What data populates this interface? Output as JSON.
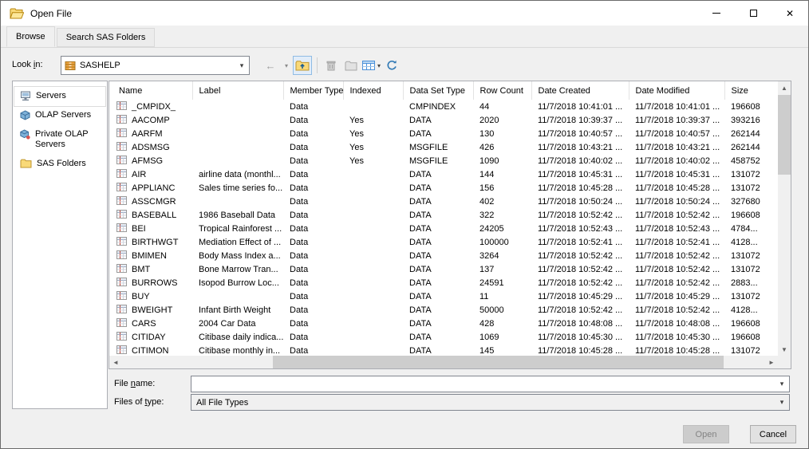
{
  "window": {
    "title": "Open File"
  },
  "icons": {
    "close": "✕",
    "back_arrow": "←",
    "caret_down": "▾",
    "scroll_up": "▲",
    "scroll_down": "▼",
    "scroll_left": "◄",
    "scroll_right": "►"
  },
  "tabs": [
    {
      "label": "Browse"
    },
    {
      "label": "Search SAS Folders"
    }
  ],
  "look_in": {
    "label": {
      "pre": "Look ",
      "accel": "i",
      "post": "n:"
    },
    "value": "SASHELP"
  },
  "sidebar": {
    "items": [
      {
        "label": "Servers"
      },
      {
        "label": "OLAP Servers"
      },
      {
        "label": "Private OLAP Servers"
      },
      {
        "label": "SAS Folders"
      }
    ]
  },
  "table": {
    "columns": [
      "Name",
      "Label",
      "Member Type",
      "Indexed",
      "Data Set Type",
      "Row Count",
      "Date Created",
      "Date Modified",
      "Size"
    ],
    "rows": [
      {
        "name": "_CMPIDX_",
        "label": "",
        "member_type": "Data",
        "indexed": "",
        "data_set_type": "CMPINDEX",
        "row_count": "44",
        "date_created": "11/7/2018 10:41:01 ...",
        "date_modified": "11/7/2018 10:41:01 ...",
        "size": "196608"
      },
      {
        "name": "AACOMP",
        "label": "",
        "member_type": "Data",
        "indexed": "Yes",
        "data_set_type": "DATA",
        "row_count": "2020",
        "date_created": "11/7/2018 10:39:37 ...",
        "date_modified": "11/7/2018 10:39:37 ...",
        "size": "393216"
      },
      {
        "name": "AARFM",
        "label": "",
        "member_type": "Data",
        "indexed": "Yes",
        "data_set_type": "DATA",
        "row_count": "130",
        "date_created": "11/7/2018 10:40:57 ...",
        "date_modified": "11/7/2018 10:40:57 ...",
        "size": "262144"
      },
      {
        "name": "ADSMSG",
        "label": "",
        "member_type": "Data",
        "indexed": "Yes",
        "data_set_type": "MSGFILE",
        "row_count": "426",
        "date_created": "11/7/2018 10:43:21 ...",
        "date_modified": "11/7/2018 10:43:21 ...",
        "size": "262144"
      },
      {
        "name": "AFMSG",
        "label": "",
        "member_type": "Data",
        "indexed": "Yes",
        "data_set_type": "MSGFILE",
        "row_count": "1090",
        "date_created": "11/7/2018 10:40:02 ...",
        "date_modified": "11/7/2018 10:40:02 ...",
        "size": "458752"
      },
      {
        "name": "AIR",
        "label": "airline data (monthl...",
        "member_type": "Data",
        "indexed": "",
        "data_set_type": "DATA",
        "row_count": "144",
        "date_created": "11/7/2018 10:45:31 ...",
        "date_modified": "11/7/2018 10:45:31 ...",
        "size": "131072"
      },
      {
        "name": "APPLIANC",
        "label": "Sales time series fo...",
        "member_type": "Data",
        "indexed": "",
        "data_set_type": "DATA",
        "row_count": "156",
        "date_created": "11/7/2018 10:45:28 ...",
        "date_modified": "11/7/2018 10:45:28 ...",
        "size": "131072"
      },
      {
        "name": "ASSCMGR",
        "label": "",
        "member_type": "Data",
        "indexed": "",
        "data_set_type": "DATA",
        "row_count": "402",
        "date_created": "11/7/2018 10:50:24 ...",
        "date_modified": "11/7/2018 10:50:24 ...",
        "size": "327680"
      },
      {
        "name": "BASEBALL",
        "label": "1986 Baseball Data",
        "member_type": "Data",
        "indexed": "",
        "data_set_type": "DATA",
        "row_count": "322",
        "date_created": "11/7/2018 10:52:42 ...",
        "date_modified": "11/7/2018 10:52:42 ...",
        "size": "196608"
      },
      {
        "name": "BEI",
        "label": "Tropical Rainforest ...",
        "member_type": "Data",
        "indexed": "",
        "data_set_type": "DATA",
        "row_count": "24205",
        "date_created": "11/7/2018 10:52:43 ...",
        "date_modified": "11/7/2018 10:52:43 ...",
        "size": "4784..."
      },
      {
        "name": "BIRTHWGT",
        "label": "Mediation Effect of ...",
        "member_type": "Data",
        "indexed": "",
        "data_set_type": "DATA",
        "row_count": "100000",
        "date_created": "11/7/2018 10:52:41 ...",
        "date_modified": "11/7/2018 10:52:41 ...",
        "size": "4128..."
      },
      {
        "name": "BMIMEN",
        "label": "Body Mass Index a...",
        "member_type": "Data",
        "indexed": "",
        "data_set_type": "DATA",
        "row_count": "3264",
        "date_created": "11/7/2018 10:52:42 ...",
        "date_modified": "11/7/2018 10:52:42 ...",
        "size": "131072"
      },
      {
        "name": "BMT",
        "label": "Bone Marrow Tran...",
        "member_type": "Data",
        "indexed": "",
        "data_set_type": "DATA",
        "row_count": "137",
        "date_created": "11/7/2018 10:52:42 ...",
        "date_modified": "11/7/2018 10:52:42 ...",
        "size": "131072"
      },
      {
        "name": "BURROWS",
        "label": "Isopod Burrow Loc...",
        "member_type": "Data",
        "indexed": "",
        "data_set_type": "DATA",
        "row_count": "24591",
        "date_created": "11/7/2018 10:52:42 ...",
        "date_modified": "11/7/2018 10:52:42 ...",
        "size": "2883..."
      },
      {
        "name": "BUY",
        "label": "",
        "member_type": "Data",
        "indexed": "",
        "data_set_type": "DATA",
        "row_count": "11",
        "date_created": "11/7/2018 10:45:29 ...",
        "date_modified": "11/7/2018 10:45:29 ...",
        "size": "131072"
      },
      {
        "name": "BWEIGHT",
        "label": "Infant Birth Weight",
        "member_type": "Data",
        "indexed": "",
        "data_set_type": "DATA",
        "row_count": "50000",
        "date_created": "11/7/2018 10:52:42 ...",
        "date_modified": "11/7/2018 10:52:42 ...",
        "size": "4128..."
      },
      {
        "name": "CARS",
        "label": "2004 Car Data",
        "member_type": "Data",
        "indexed": "",
        "data_set_type": "DATA",
        "row_count": "428",
        "date_created": "11/7/2018 10:48:08 ...",
        "date_modified": "11/7/2018 10:48:08 ...",
        "size": "196608"
      },
      {
        "name": "CITIDAY",
        "label": "Citibase daily indica...",
        "member_type": "Data",
        "indexed": "",
        "data_set_type": "DATA",
        "row_count": "1069",
        "date_created": "11/7/2018 10:45:30 ...",
        "date_modified": "11/7/2018 10:45:30 ...",
        "size": "196608"
      },
      {
        "name": "CITIMON",
        "label": "Citibase monthly in...",
        "member_type": "Data",
        "indexed": "",
        "data_set_type": "DATA",
        "row_count": "145",
        "date_created": "11/7/2018 10:45:28 ...",
        "date_modified": "11/7/2018 10:45:28 ...",
        "size": "131072"
      }
    ]
  },
  "file_name": {
    "label": {
      "pre": "File ",
      "accel": "n",
      "post": "ame:"
    },
    "value": ""
  },
  "files_of_type": {
    "label": {
      "pre": "Files of ",
      "accel": "t",
      "post": "ype:"
    },
    "value": "All File Types"
  },
  "buttons": {
    "open": "Open",
    "cancel": "Cancel"
  }
}
